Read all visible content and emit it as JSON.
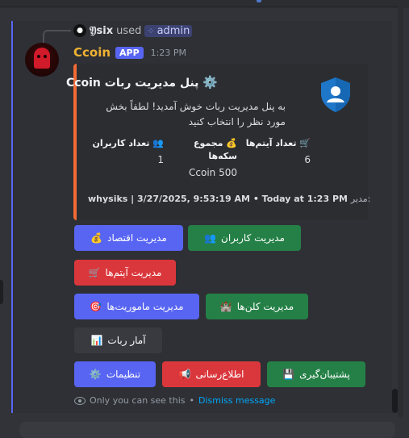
{
  "reply": {
    "user": "𝔜six",
    "used": "used",
    "command": "admin"
  },
  "message": {
    "bot_name": "Ccoin",
    "app_tag": "APP",
    "time": "1:23 PM"
  },
  "embed": {
    "title": "پنل مدیریت ربات Ccoin",
    "description": "به پنل مدیریت ربات خوش آمدید! لطفاً بخش مورد نظر را انتخاب کنید",
    "fields": [
      {
        "name": "🛒 تعداد آیتم‌ها",
        "value": "6"
      },
      {
        "name": "💰 مجموع سکه‌ها",
        "value": "500 Ccoin"
      },
      {
        "name": "👥 تعداد کاربران",
        "value": "1"
      }
    ],
    "footer_prefix": "مدیر: ",
    "footer": "whysiks | 3/27/2025, 9:53:19 AM • Today at 1:23 PM",
    "accent_color": "#f26a35"
  },
  "buttons": {
    "user_mgmt": "مدیریت کاربران",
    "economy_mgmt": "مدیریت اقتصاد",
    "items_mgmt": "مدیریت آیتم‌ها",
    "clan_mgmt": "مدیریت کلن‌ها",
    "mission_mgmt": "مدیریت ماموریت‌ها",
    "bot_stats": "آمار ربات",
    "backup": "پشتیبان‌گیری",
    "announce": "اطلاع‌رسانی",
    "settings": "تنظیمات"
  },
  "icons": {
    "user_mgmt": "👥",
    "economy_mgmt": "💰",
    "items_mgmt": "🛒",
    "clan_mgmt": "🏰",
    "mission_mgmt": "🎯",
    "bot_stats": "📊",
    "backup": "💾",
    "announce": "📢",
    "settings": "⚙️"
  },
  "ephemeral": {
    "text": "Only you can see this",
    "sep": "•",
    "dismiss": "Dismiss message"
  }
}
